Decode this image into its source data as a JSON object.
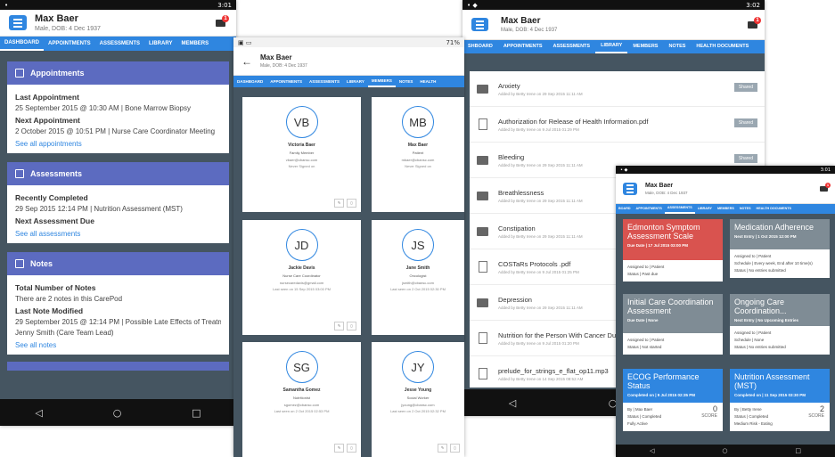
{
  "patient": {
    "name": "Max Baer",
    "sub": "Male, DOB: 4 Dec 1937"
  },
  "status": {
    "s1_time": "3:01",
    "s2_time": "71%",
    "s3_time": "3:02",
    "s4_time": "3:01"
  },
  "notifications": {
    "badge": "1"
  },
  "tabs": [
    "DASHBOARD",
    "APPOINTMENTS",
    "ASSESSMENTS",
    "LIBRARY",
    "MEMBERS",
    "NOTES",
    "HEALTH DOCUMENTS"
  ],
  "tabs_short": [
    "DASHBOARD",
    "APPOINTMENTS",
    "ASSESSMENTS",
    "LIBRARY",
    "MEMBERS",
    "NOTES",
    "HEALTH"
  ],
  "s3_tabs": [
    "SHBOARD",
    "APPOINTMENTS",
    "ASSESSMENTS",
    "LIBRARY",
    "MEMBERS",
    "NOTES",
    "HEALTH DOCUMENTS"
  ],
  "s4_tabs": [
    "BOARD",
    "APPOINTMENTS",
    "ASSESSMENTS",
    "LIBRARY",
    "MEMBERS",
    "NOTES",
    "HEALTH DOCUMENTS"
  ],
  "dashboard": {
    "appointments": {
      "title": "Appointments",
      "last_label": "Last Appointment",
      "last_value": "25 September 2015 @ 10:30 AM | Bone Marrow Biopsy",
      "next_label": "Next Appointment",
      "next_value": "2 October 2015 @ 10:51 PM | Nurse Care Coordinator Meeting",
      "link": "See all appointments"
    },
    "assessments": {
      "title": "Assessments",
      "recent_label": "Recently Completed",
      "recent_value": "29 Sep 2015 12:14 PM | Nutrition Assessment (MST)",
      "next_label": "Next Assessment Due",
      "link": "See all assessments"
    },
    "notes": {
      "title": "Notes",
      "total_label": "Total Number of Notes",
      "total_value": "There are 2 notes in this CarePod",
      "modified_label": "Last Note Modified",
      "modified_value": "29 September 2015 @ 12:14 PM | Possible Late Effects of Treatm",
      "modified_by": "Jenny Smith (Care Team Lead)",
      "link": "See all notes"
    }
  },
  "nav": {
    "back": "◁",
    "home": "○",
    "recent": "□"
  },
  "members": [
    {
      "initials": "VB",
      "name": "Victoria Baer",
      "role": "Family Member",
      "email": "vbaer@cbansc.com",
      "last": "Never Signed on"
    },
    {
      "initials": "MB",
      "name": "Max Baer",
      "role": "Patient",
      "email": "mbaer@cbansc.com",
      "last": "Never Signed on"
    },
    {
      "initials": "JD",
      "name": "Jackie Davis",
      "role": "Nurse Care Coordinator",
      "email": "nursecaredavis@gmail.com",
      "last": "Last seen on 15 Sep 2015 03:00 PM"
    },
    {
      "initials": "JS",
      "name": "Jane Smith",
      "role": "Oncologist",
      "email": "jsmith@cbansc.com",
      "last": "Last seen on 2 Oct 2015 02:30 PM"
    },
    {
      "initials": "SG",
      "name": "Samantha Gomez",
      "role": "Nutritionist",
      "email": "sgomez@cbansc.com",
      "last": "Last seen on 2 Oct 2015 02:53 PM"
    },
    {
      "initials": "JY",
      "name": "Jesse Young",
      "role": "Social Worker",
      "email": "jyoung@cbansc.com",
      "last": "Last seen on 2 Oct 2015 02:32 PM"
    }
  ],
  "library": {
    "shared_label": "Shared",
    "items": [
      {
        "title": "Anxiety",
        "by": "Added by Betty Irene on 29 Sep 2015 11:11 AM",
        "kind": "folder",
        "shared": true
      },
      {
        "title": "Authorization for Release of Health Information.pdf",
        "by": "Added by Betty Irene on 9 Jul 2015 01:29 PM",
        "kind": "file",
        "shared": true
      },
      {
        "title": "Bleeding",
        "by": "Added by Betty Irene on 29 Sep 2015 11:11 AM",
        "kind": "folder",
        "shared": true
      },
      {
        "title": "Breathlessness",
        "by": "Added by Betty Irene on 29 Sep 2015 11:11 AM",
        "kind": "folder",
        "shared": false
      },
      {
        "title": "Constipation",
        "by": "Added by Betty Irene on 29 Sep 2015 11:11 AM",
        "kind": "folder",
        "shared": false
      },
      {
        "title": "COSTaRs Protocols .pdf",
        "by": "Added by Betty Irene on 9 Jul 2015 01:25 PM",
        "kind": "file",
        "shared": false
      },
      {
        "title": "Depression",
        "by": "Added by Betty Irene on 29 Sep 2015 11:11 AM",
        "kind": "folder",
        "shared": false
      },
      {
        "title": "Nutrition for the Person With Cancer Du Treatment.pdf",
        "by": "Added by Betty Irene on 9 Jul 2015 01:20 PM",
        "kind": "file",
        "shared": false
      },
      {
        "title": "prelude_for_strings_e_flat_op11.mp3",
        "by": "Added by Betty Irene on 14 Sep 2015 08:52 AM",
        "kind": "audio",
        "shared": false
      }
    ]
  },
  "assessment_cards": [
    {
      "title": "Edmonton Symptom Assessment Scale",
      "date": "Due Date | 17 Jul 2015 03:00 PM",
      "line1": "Assigned to | Patient",
      "line2": "Status | Past due",
      "line3": "",
      "color": "#d9534f",
      "score": "",
      "score_label": ""
    },
    {
      "title": "Medication Adherence",
      "date": "Next Entry | 1 Oct 2015 12:00 PM",
      "line1": "Assigned to | Patient",
      "line2": "Schedule | Every week, End after 10 time(s)",
      "line3": "Status | No entries submitted",
      "color": "#7f8c95",
      "score": "",
      "score_label": ""
    },
    {
      "title": "Initial Care Coordination Assessment",
      "date": "Due Date | None",
      "line1": "Assigned to | Patient",
      "line2": "Status | Not started",
      "line3": "",
      "color": "#7f8c95",
      "score": "",
      "score_label": ""
    },
    {
      "title": "Ongoing Care Coordination...",
      "date": "Next Entry | No Upcoming Entries",
      "line1": "Assigned to | Patient",
      "line2": "Schedule | None",
      "line3": "Status | No entries submitted",
      "color": "#7f8c95",
      "score": "",
      "score_label": ""
    },
    {
      "title": "ECOG Performance Status",
      "date": "Completed on | 9 Jul 2015 02:35 PM",
      "line1": "By | Max Baer",
      "line2": "Status | Completed",
      "line3": "Fully Active",
      "color": "#2f86e0",
      "score": "0",
      "score_label": "SCORE"
    },
    {
      "title": "Nutrition Assessment (MST)",
      "date": "Completed on | 11 Sep 2015 03:30 PM",
      "line1": "By | Betty Irene",
      "line2": "Status | Completed",
      "line3": "Medium Risk - Eating",
      "color": "#2f86e0",
      "score": "2",
      "score_label": "SCORE"
    }
  ]
}
